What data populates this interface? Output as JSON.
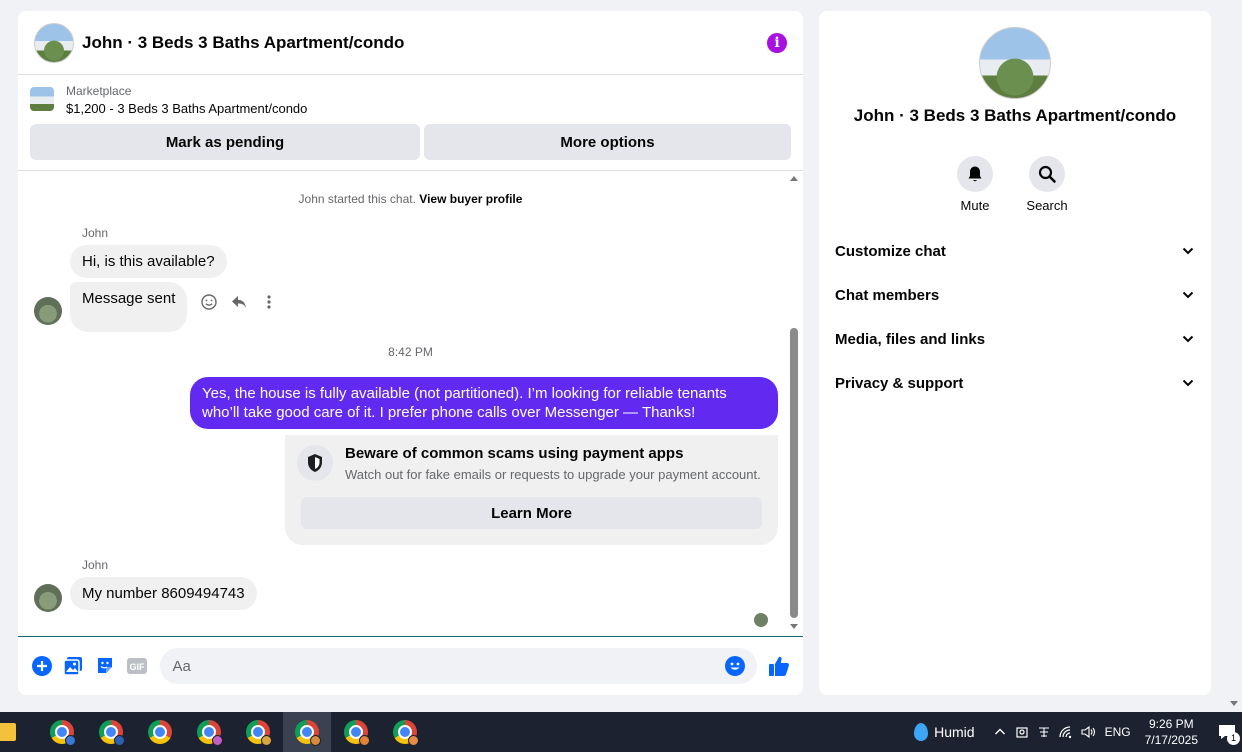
{
  "chat": {
    "title": "John · 3 Beds 3 Baths Apartment/condo",
    "listing_source": "Marketplace",
    "listing_name": "$1,200 - 3 Beds 3 Baths Apartment/condo",
    "mark_pending_label": "Mark as pending",
    "more_options_label": "More options",
    "started_text": "John started this chat.",
    "view_profile_label": "View buyer profile",
    "sender1": "John",
    "msg1": "Hi, is this available?",
    "msg2": "Message sent",
    "time": "8:42 PM",
    "reply": "Yes, the house is fully available (not partitioned). I’m looking for reliable tenants who’ll take good care of it. I prefer phone calls over Messenger —  Thanks!",
    "warning_title": "Beware of common scams using payment apps",
    "warning_desc": "Watch out for fake emails or requests to upgrade your payment account.",
    "learn_more_label": "Learn More",
    "sender2": "John",
    "msg3": "My number 8609494743",
    "composer_placeholder": "Aa",
    "composer_icons": [
      "add-icon",
      "photo-icon",
      "sticker-icon",
      "gif-icon",
      "emoji-icon",
      "thumbs-up-icon"
    ],
    "gif_label": "GIF"
  },
  "side": {
    "title": "John · 3 Beds 3 Baths Apartment/condo",
    "mute_label": "Mute",
    "search_label": "Search",
    "sections": [
      "Customize chat",
      "Chat members",
      "Media, files and links",
      "Privacy & support"
    ]
  },
  "taskbar": {
    "weather": "Humid",
    "lang": "ENG",
    "time": "9:26 PM",
    "date": "7/17/2025",
    "notifications": "1"
  },
  "colors": {
    "accent": "#6229f0",
    "info": "#a80fe0",
    "icon_blue": "#0866ff"
  }
}
